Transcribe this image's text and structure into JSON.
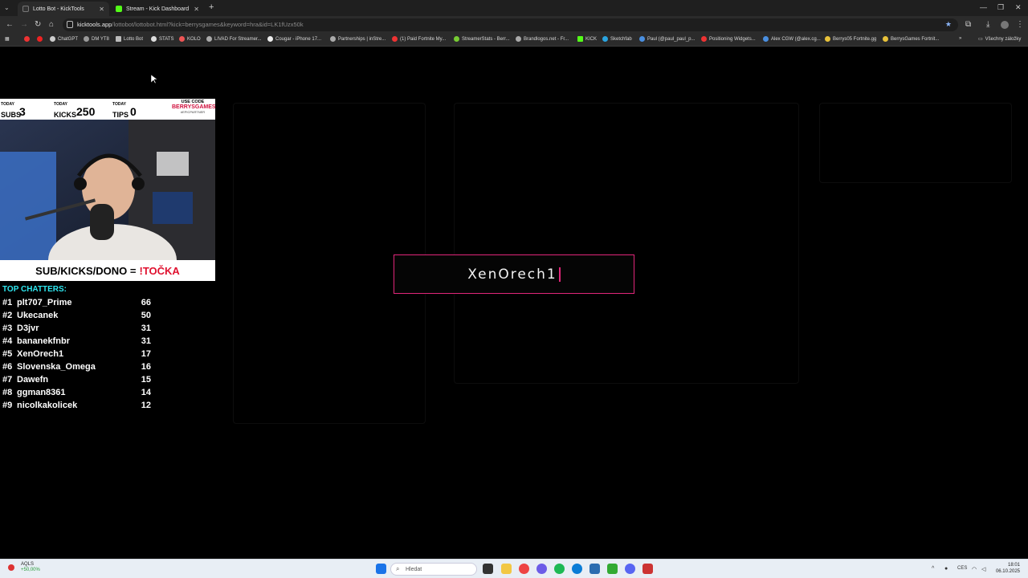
{
  "browser": {
    "tabs": [
      {
        "title": "Lotto Bot - KickTools",
        "active": true
      },
      {
        "title": "Stream - Kick Dashboard",
        "active": false
      }
    ],
    "url_host": "kicktools.app",
    "url_path": "/lottobot/lottobot.html?kick=berrysgames&keyword=hra&id=LK1fUzx50k",
    "bookmarks": [
      "ChatGPT",
      "DM YT8",
      "Lotto Bot",
      "STATS",
      "KOLO",
      "LIVAD For Streamer...",
      "Cougar - iPhone 17...",
      "Partnerships | inStre...",
      "(1) Paid Fortnite My...",
      "StreamerStats - Berr...",
      "Brandlogos.net - Fr...",
      "KICK",
      "Sketchfab",
      "Paul (@paul_paul_p...",
      "Positioning Widgets...",
      "Alex CGW (@alex.cg...",
      "Berrys05 Fortnite.gg",
      "BerrysGames Fortnit...",
      "Všechny záložky"
    ]
  },
  "overlay": {
    "stats": [
      {
        "small": "TODAY",
        "label": "SUBS",
        "value": "3"
      },
      {
        "small": "TODAY",
        "label": "KICKS",
        "value": "250"
      },
      {
        "small": "TODAY",
        "label": "TIPS",
        "value": "0"
      }
    ],
    "promo": {
      "line1": "USE CODE",
      "line2": "BERRYSGAMES",
      "line3": "#EPICPARTNER"
    },
    "banner_prefix": "SUB/KICKS/DONO =",
    "banner_highlight": "!TOČKA"
  },
  "top_chatters": {
    "title": "TOP CHATTERS:",
    "rows": [
      {
        "rank": "#1",
        "name": "plt707_Prime",
        "count": "66"
      },
      {
        "rank": "#2",
        "name": "Ukecanek",
        "count": "50"
      },
      {
        "rank": "#3",
        "name": "D3jvr",
        "count": "31"
      },
      {
        "rank": "#4",
        "name": "bananekfnbr",
        "count": "31"
      },
      {
        "rank": "#5",
        "name": "XenOrech1",
        "count": "17"
      },
      {
        "rank": "#6",
        "name": "Slovenska_Omega",
        "count": "16"
      },
      {
        "rank": "#7",
        "name": "Dawefn",
        "count": "15"
      },
      {
        "rank": "#8",
        "name": "ggman8361",
        "count": "14"
      },
      {
        "rank": "#9",
        "name": "nicolkakolicek",
        "count": "12"
      }
    ]
  },
  "popup": {
    "winner": "XenOrech1"
  },
  "taskbar": {
    "weather_label": "AQLS",
    "weather_change": "+50,00%",
    "search_placeholder": "Hledat",
    "lang": "CES",
    "time": "18:01",
    "date": "06.10.2025"
  }
}
